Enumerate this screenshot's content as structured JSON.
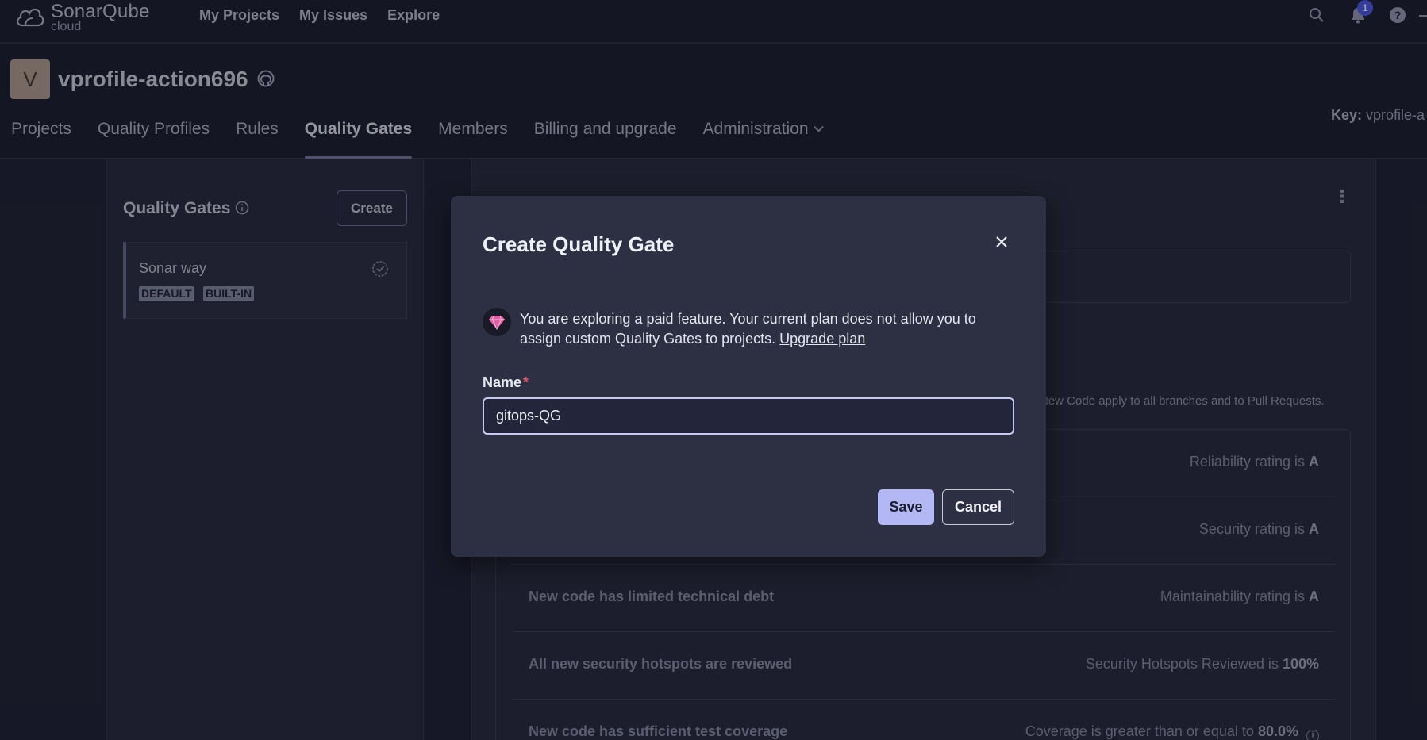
{
  "topbar": {
    "brand_title": "SonarQube",
    "brand_sub": "cloud",
    "nav": [
      "My Projects",
      "My Issues",
      "Explore"
    ],
    "notification_count": "1",
    "icons": [
      "search-icon",
      "bell-icon",
      "help-icon"
    ]
  },
  "org": {
    "avatar_letter": "V",
    "name": "vprofile-action696",
    "key_label": "Key:",
    "key_value": "vprofile-a",
    "tabs": [
      "Projects",
      "Quality Profiles",
      "Rules",
      "Quality Gates",
      "Members",
      "Billing and upgrade",
      "Administration"
    ],
    "active_tab": "Quality Gates"
  },
  "sidebar": {
    "heading": "Quality Gates",
    "create_label": "Create",
    "gates": [
      {
        "name": "Sonar way",
        "badges": [
          "DEFAULT",
          "BUILT-IN"
        ]
      }
    ]
  },
  "main": {
    "conditions_note": "New Code apply to all branches and to Pull Requests.",
    "conditions": [
      {
        "label": "",
        "metric": "Reliability rating is",
        "value": "A"
      },
      {
        "label": "",
        "metric": "Security rating is",
        "value": "A"
      },
      {
        "label": "New code has limited technical debt",
        "metric": "Maintainability rating is",
        "value": "A"
      },
      {
        "label": "All new security hotspots are reviewed",
        "metric": "Security Hotspots Reviewed is",
        "value": "100%"
      },
      {
        "label": "New code has sufficient test coverage",
        "metric": "Coverage is greater than or equal to",
        "value": "80.0%"
      }
    ]
  },
  "modal": {
    "title": "Create Quality Gate",
    "paid_message": "You are exploring a paid feature. Your current plan does not allow you to assign custom Quality Gates to projects.",
    "upgrade_link": "Upgrade plan",
    "name_label": "Name",
    "required_mark": "*",
    "name_value": "gitops-QG",
    "save_label": "Save",
    "cancel_label": "Cancel",
    "accent_color": "#b3b7f3"
  }
}
